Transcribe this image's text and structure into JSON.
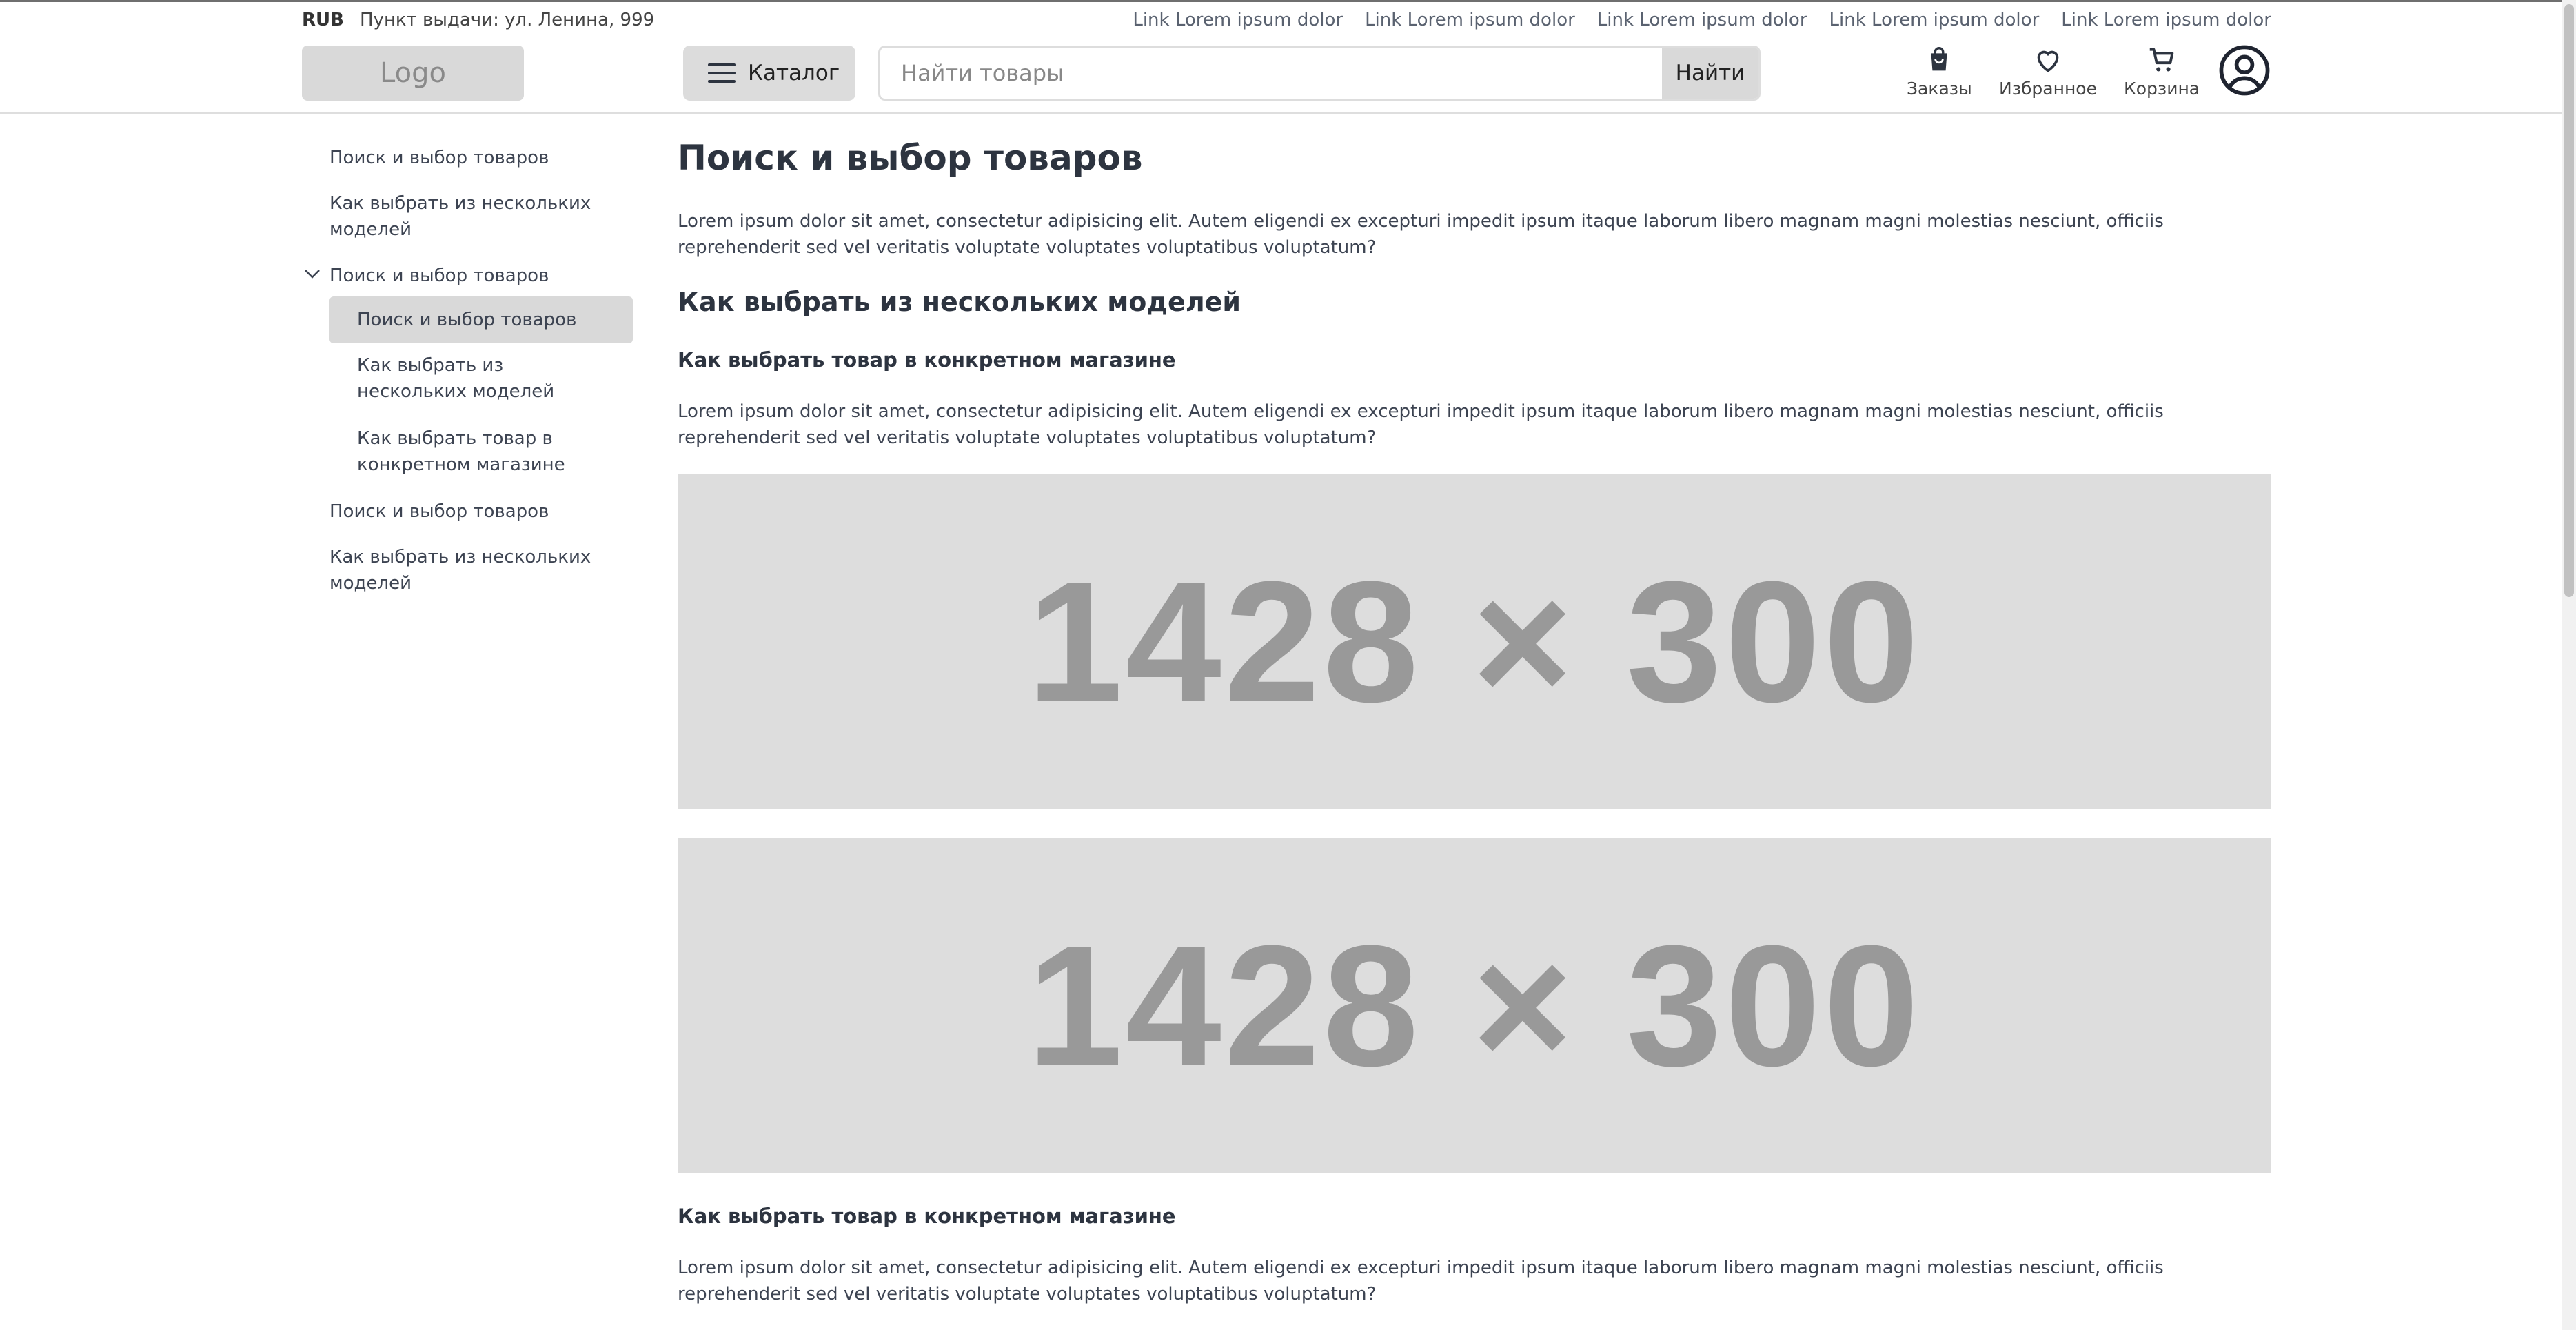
{
  "top": {
    "currency": "RUB",
    "pickup": "Пункт выдачи: ул. Ленина, 999",
    "links": [
      "Link Lorem ipsum dolor",
      "Link Lorem ipsum dolor",
      "Link Lorem ipsum dolor",
      "Link Lorem ipsum dolor",
      "Link Lorem ipsum dolor"
    ]
  },
  "header": {
    "logo": "Logo",
    "catalog": "Каталог",
    "search_placeholder": "Найти товары",
    "search_button": "Найти",
    "orders": "Заказы",
    "favorites": "Избранное",
    "cart": "Корзина"
  },
  "sidebar": {
    "items": [
      "Поиск и выбор товаров",
      "Как выбрать из нескольких моделей",
      "Поиск и выбор товаров",
      "Поиск и выбор товаров",
      "Как выбрать из нескольких моделей",
      "Как выбрать товар в конкретном магазине",
      "Поиск и выбор товаров",
      "Как выбрать из нескольких моделей"
    ]
  },
  "main": {
    "title": "Поиск и выбор товаров",
    "p1": "Lorem ipsum dolor sit amet, consectetur adipisicing elit. Autem eligendi ex excepturi impedit ipsum itaque laborum libero magnam magni molestias nesciunt, officiis reprehenderit sed vel veritatis voluptate voluptates voluptatibus voluptatum?",
    "h2": "Как выбрать из нескольких моделей",
    "h3a": "Как выбрать товар в конкретном магазине",
    "p2": "Lorem ipsum dolor sit amet, consectetur adipisicing elit. Autem eligendi ex excepturi impedit ipsum itaque laborum libero magnam magni molestias nesciunt, officiis reprehenderit sed vel veritatis voluptate voluptates voluptatibus voluptatum?",
    "img1": "1428 × 300",
    "img2": "1428 × 300",
    "h3b": "Как выбрать товар в конкретном магазине",
    "p3": "Lorem ipsum dolor sit amet, consectetur adipisicing elit. Autem eligendi ex excepturi impedit ipsum itaque laborum libero magnam magni molestias nesciunt, officiis reprehenderit sed vel veritatis voluptate voluptates voluptatibus voluptatum?"
  }
}
